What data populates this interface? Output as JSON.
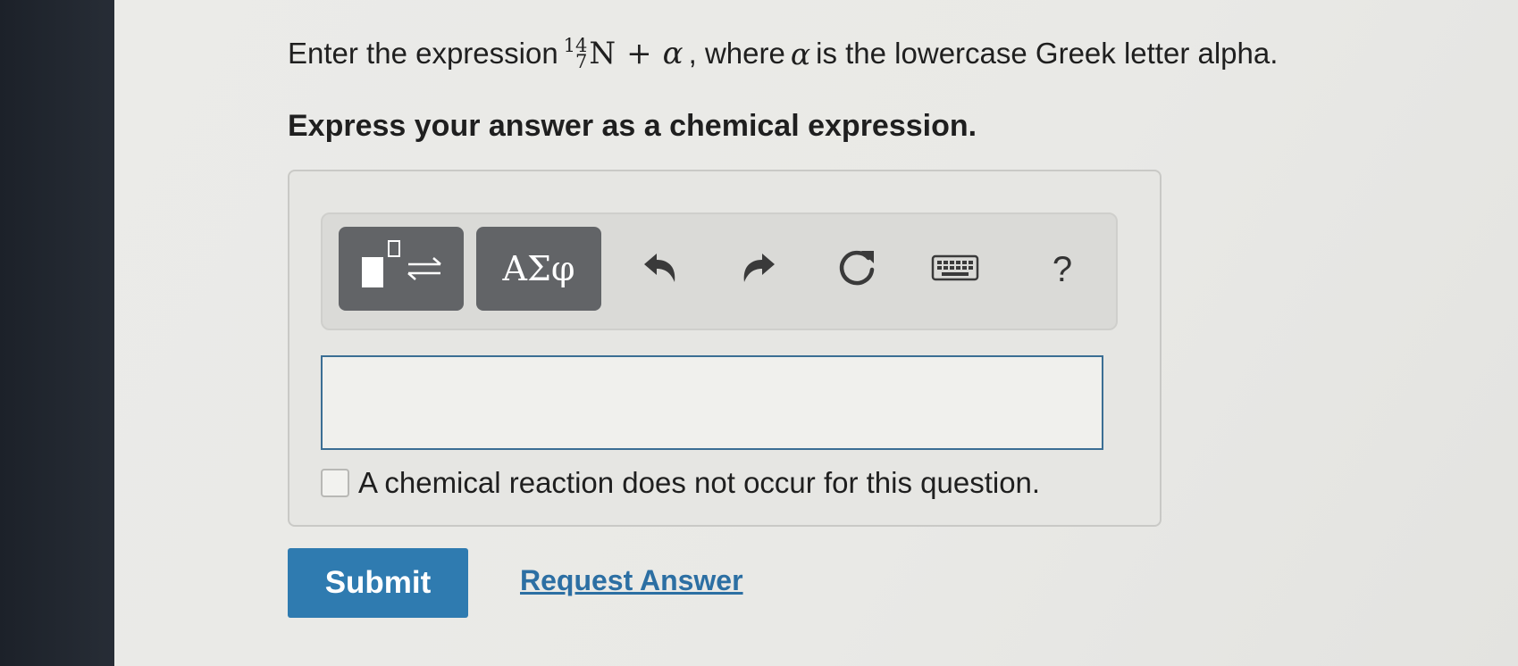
{
  "question": {
    "prompt_before": "Enter the expression",
    "isotope": {
      "mass_number": "14",
      "atomic_number": "7",
      "symbol": "N"
    },
    "operator": "+",
    "alpha_symbol": "α",
    "prompt_middle": ", where",
    "prompt_alpha": "α",
    "prompt_after": "is the lowercase Greek letter alpha.",
    "instruction": "Express your answer as a chemical expression."
  },
  "toolbar": {
    "greek_label": "ΑΣφ",
    "help_label": "?",
    "icons": [
      "templates-icon",
      "undo-icon",
      "redo-icon",
      "reset-icon",
      "keyboard-icon",
      "help-icon"
    ]
  },
  "answer": {
    "value": "",
    "no_reaction_label": "A chemical reaction does not occur for this question.",
    "no_reaction_checked": false
  },
  "actions": {
    "submit_label": "Submit",
    "request_label": "Request Answer"
  },
  "colors": {
    "submit_bg": "#2f7bb0",
    "link": "#2c6fa3",
    "toolbar_button": "#626467"
  }
}
